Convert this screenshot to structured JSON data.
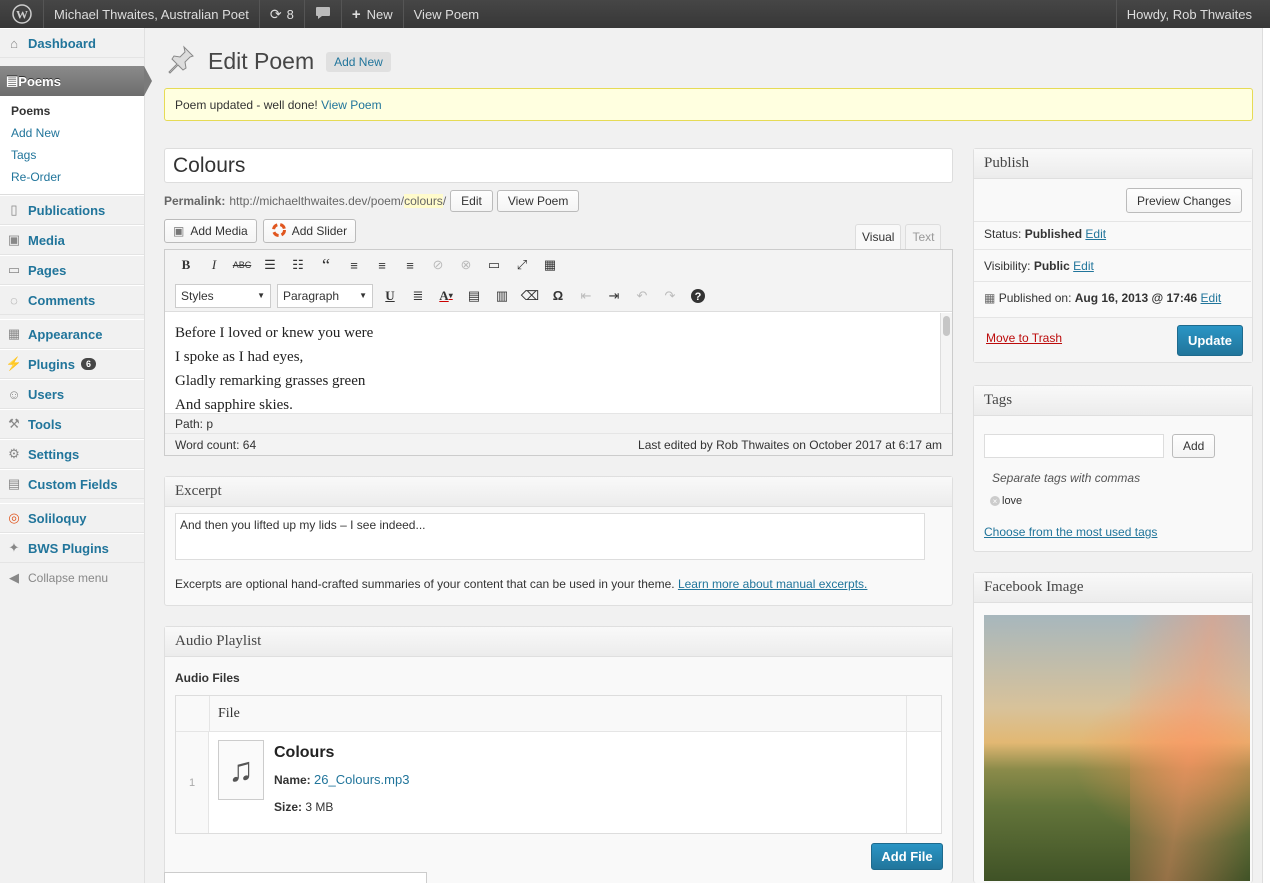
{
  "adminbar": {
    "site_name": "Michael Thwaites, Australian Poet",
    "updates_count": "8",
    "new_label": "New",
    "view_label": "View Poem",
    "howdy": "Howdy, Rob Thwaites"
  },
  "sidebar": {
    "dashboard": "Dashboard",
    "poems": "Poems",
    "sub": [
      "Poems",
      "Add New",
      "Tags",
      "Re-Order"
    ],
    "items": [
      "Publications",
      "Media",
      "Pages",
      "Comments"
    ],
    "items2": [
      "Appearance",
      "Plugins",
      "Users",
      "Tools",
      "Settings",
      "Custom Fields"
    ],
    "plugins_badge": "6",
    "items3": [
      "Soliloquy",
      "BWS Plugins"
    ],
    "collapse": "Collapse menu"
  },
  "header": {
    "title": "Edit Poem",
    "add_new": "Add New"
  },
  "notice": {
    "text": "Poem updated - well done!",
    "link": "View Poem"
  },
  "post": {
    "title": "Colours",
    "permalink_label": "Permalink:",
    "permalink_base": "http://michaelthwaites.dev/poem/",
    "permalink_slug": "colours",
    "permalink_end": "/",
    "edit_btn": "Edit",
    "view_btn": "View Poem"
  },
  "editor": {
    "add_media": "Add Media",
    "add_slider": "Add Slider",
    "tab_visual": "Visual",
    "tab_text": "Text",
    "styles": "Styles",
    "paragraph": "Paragraph",
    "lines": [
      "Before I loved or knew you were",
      "I spoke as I had eyes,",
      "Gladly remarking grasses green",
      "And sapphire skies."
    ],
    "path": "Path: p",
    "word_count": "Word count: 64",
    "last_edited": "Last edited by Rob Thwaites on October 2017 at 6:17 am"
  },
  "excerpt": {
    "heading": "Excerpt",
    "value": "And then you lifted up my lids – I see indeed...",
    "note": "Excerpts are optional hand-crafted summaries of your content that can be used in your theme.",
    "learn_more": "Learn more about manual excerpts."
  },
  "audio": {
    "heading": "Audio Playlist",
    "files_label": "Audio Files",
    "col_file": "File",
    "row_index": "1",
    "file_title": "Colours",
    "name_label": "Name:",
    "name_value": "26_Colours.mp3",
    "size_label": "Size:",
    "size_value": "3 MB",
    "add_file": "Add File"
  },
  "publish": {
    "heading": "Publish",
    "preview": "Preview Changes",
    "status_label": "Status:",
    "status_value": "Published",
    "visibility_label": "Visibility:",
    "visibility_value": "Public",
    "published_label": "Published on:",
    "published_value": "Aug 16, 2013 @ 17:46",
    "edit": "Edit",
    "trash": "Move to Trash",
    "update": "Update"
  },
  "tags": {
    "heading": "Tags",
    "add_btn": "Add",
    "hint": "Separate tags with commas",
    "tag": "love",
    "choose": "Choose from the most used tags"
  },
  "facebook": {
    "heading": "Facebook Image"
  },
  "colors": {
    "link": "#21759b",
    "primary": "#21759b",
    "notice_bg": "#ffffe0",
    "trash": "#bc0b0b"
  }
}
